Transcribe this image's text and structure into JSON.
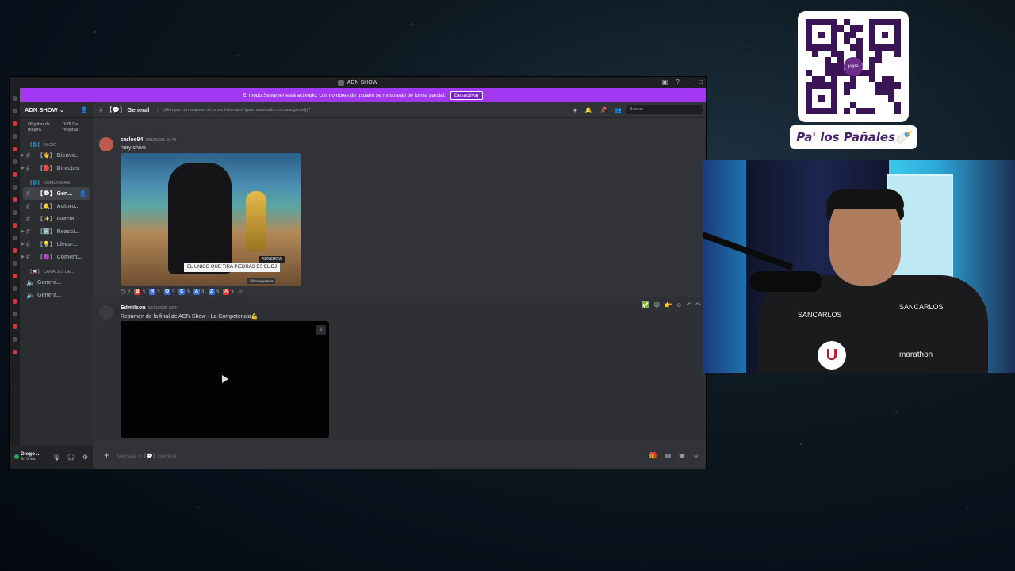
{
  "window": {
    "title": "ADN SHOW",
    "banner_text": "El modo Streamer está activado. Los nombres de usuario se mostrarán de forma parcial.",
    "banner_button": "Desactivar"
  },
  "server": {
    "name": "ADN SHOW",
    "boost_label": "Objetivo de mejora",
    "boost_progress": "0/28 De mejoras"
  },
  "categories": {
    "inicio": "【🌐】 INICIO",
    "comunidad": "【🌐】 COMUNIDAD",
    "canales": "【📢】 CANALES DE..."
  },
  "channels": [
    {
      "label": "【👋】 Bienve..."
    },
    {
      "label": "【🔴】 Directos"
    },
    {
      "label": "【💬】 Gen..."
    },
    {
      "label": "【🔔】 Autoro..."
    },
    {
      "label": "【✨】 Gracia..."
    },
    {
      "label": "【🆒】 Reacci..."
    },
    {
      "label": "【💡】 Ideas-..."
    },
    {
      "label": "【🟣】 Coment..."
    }
  ],
  "voice_channels": [
    {
      "label": "Genera..."
    },
    {
      "label": "Genera..."
    }
  ],
  "user": {
    "name": "Diego ...",
    "status": "En línea"
  },
  "chat": {
    "channel_name": "General",
    "channel_prefix": "【💬】",
    "topic": "¡Siempre con respeto, si no será borrado! (guerra avisada no mata gente)|||*",
    "search_placeholder": "Buscar",
    "composer_placeholder": "Mensaje #【💬】General"
  },
  "messages": [
    {
      "author": "carlos94",
      "timestamp": "18/11/2025 19:44",
      "text": "nery chivo",
      "image_caption": "EL UNICO QUE TIRA PIEDRAS ES EL DJ",
      "image_tag": "ADNSHOW",
      "image_handle": "@hansgutama",
      "reactions": [
        {
          "emoji": "😏",
          "count": "2"
        },
        {
          "emoji": "B",
          "count": "3",
          "color": "#e03b3b"
        },
        {
          "emoji": "R",
          "count": "3",
          "color": "#3b6fe0"
        },
        {
          "emoji": "O",
          "count": "3",
          "color": "#3b6fe0"
        },
        {
          "emoji": "C",
          "count": "3",
          "color": "#3b6fe0"
        },
        {
          "emoji": "A",
          "count": "3",
          "color": "#3b6fe0"
        },
        {
          "emoji": "Z",
          "count": "3",
          "color": "#3b6fe0"
        },
        {
          "emoji": "A",
          "count": "3",
          "color": "#e03b3b"
        }
      ]
    },
    {
      "author": "Edmilson",
      "timestamp": "18/11/2025 20:44",
      "text": "Resumen de la final de ADN Show - La Competencia💪"
    }
  ],
  "overlay": {
    "qr_brand": "yape",
    "sign_text": "Pa' los Pañales🍼"
  },
  "webcam": {
    "shirt_brand_1": "SANCARLOS",
    "shirt_brand_2": "marathon",
    "shirt_logo": "U"
  },
  "colors": {
    "banner": "#a238f2",
    "discord_bg": "#313338",
    "sidebar_bg": "#2b2d31",
    "sign_text": "#4a1f6b"
  }
}
